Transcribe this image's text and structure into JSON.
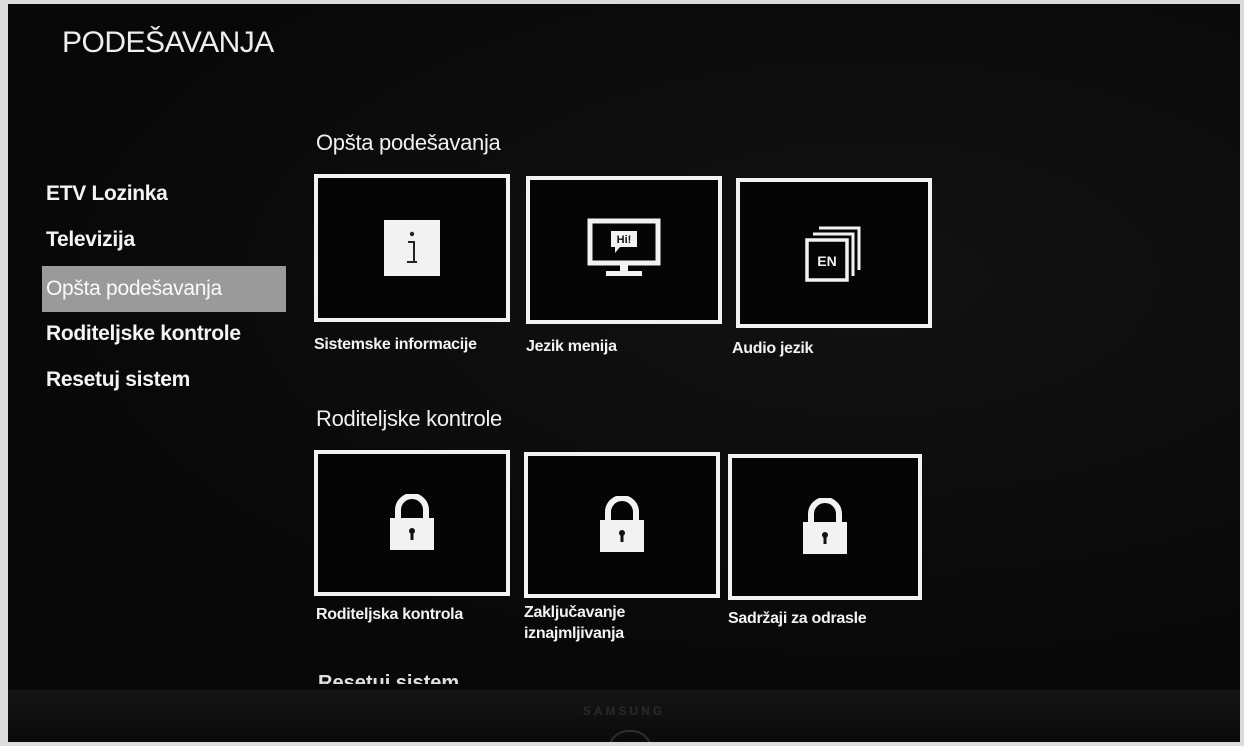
{
  "header": {
    "title": "PODEŠAVANJA"
  },
  "sidebar": {
    "items": [
      {
        "label": "ETV Lozinka",
        "active": false
      },
      {
        "label": "Televizija",
        "active": false
      },
      {
        "label": "Opšta podešavanja",
        "active": true
      },
      {
        "label": "Roditeljske kontrole",
        "active": false
      },
      {
        "label": "Resetuj sistem",
        "active": false
      }
    ]
  },
  "sections": [
    {
      "title": "Opšta podešavanja",
      "tiles": [
        {
          "label": "Sistemske informacije",
          "icon": "info-icon"
        },
        {
          "label": "Jezik menija",
          "icon": "tv-hi-icon",
          "icon_text": "Hi!"
        },
        {
          "label": "Audio jezik",
          "icon": "language-en-icon",
          "icon_text": "EN"
        }
      ]
    },
    {
      "title": "Roditeljske kontrole",
      "tiles": [
        {
          "label": "Roditeljska kontrola",
          "icon": "lock-icon"
        },
        {
          "label": "Zaključavanje iznajmljivanja",
          "icon": "lock-icon"
        },
        {
          "label": "Sadržaji za odrasle",
          "icon": "lock-icon"
        }
      ]
    },
    {
      "title": "Resetuj sistem"
    }
  ],
  "device": {
    "brand": "SAMSUNG"
  },
  "colors": {
    "background": "#0b0b0b",
    "active_item": "#9a9a9a",
    "tile_border": "#f2f2f2"
  }
}
